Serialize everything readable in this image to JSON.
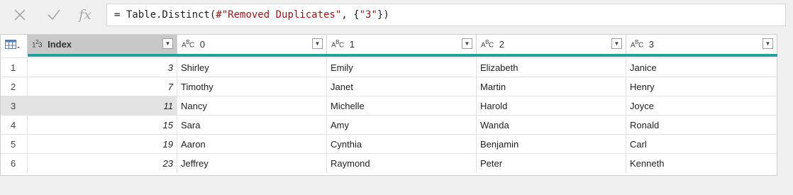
{
  "formula_bar": {
    "cancel_icon": "close-icon",
    "commit_icon": "check-icon",
    "fx_label": "fx",
    "formula_prefix": "= Table.Distinct(",
    "formula_str1": "#\"Removed Duplicates\"",
    "formula_mid": ", {",
    "formula_str2": "\"3\"",
    "formula_suffix": "})"
  },
  "table": {
    "columns": [
      {
        "type": "123",
        "name": "Index"
      },
      {
        "type": "ABC",
        "name": "0"
      },
      {
        "type": "ABC",
        "name": "1"
      },
      {
        "type": "ABC",
        "name": "2"
      },
      {
        "type": "ABC",
        "name": "3"
      }
    ],
    "rows": [
      {
        "n": "1",
        "cells": [
          "3",
          "Shirley",
          "Emily",
          "Elizabeth",
          "Janice"
        ]
      },
      {
        "n": "2",
        "cells": [
          "7",
          "Timothy",
          "Janet",
          "Martin",
          "Henry"
        ]
      },
      {
        "n": "3",
        "cells": [
          "11",
          "Nancy",
          "Michelle",
          "Harold",
          "Joyce"
        ]
      },
      {
        "n": "4",
        "cells": [
          "15",
          "Sara",
          "Amy",
          "Wanda",
          "Ronald"
        ]
      },
      {
        "n": "5",
        "cells": [
          "19",
          "Aaron",
          "Cynthia",
          "Benjamin",
          "Carl"
        ]
      },
      {
        "n": "6",
        "cells": [
          "23",
          "Jeffrey",
          "Raymond",
          "Peter",
          "Kenneth"
        ]
      }
    ],
    "selected_row": 3,
    "accent_color": "#1fa39a"
  }
}
